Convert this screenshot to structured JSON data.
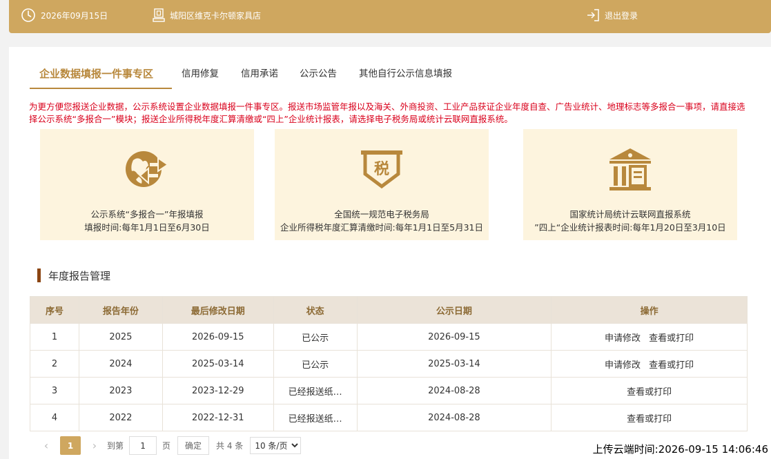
{
  "topbar": {
    "date": "2026年09月15日",
    "shop": "城阳区维克卡尔顿家具店",
    "logout": "退出登录"
  },
  "tabs": [
    {
      "label": "企业数据填报一件事专区",
      "active": true
    },
    {
      "label": "信用修复"
    },
    {
      "label": "信用承诺"
    },
    {
      "label": "公示公告"
    },
    {
      "label": "其他自行公示信息填报"
    }
  ],
  "notice": "为更方便您报送企业数据，公示系统设置企业数据填报一件事专区。报送市场监管年报以及海关、外商投资、工业产品获证企业年度自查、广告业统计、地理标志等多报合一事项，请直接选择公示系统“多报合一”模块；报送企业所得税年度汇算清缴或“四上”企业统计报表，请选择电子税务局或统计云联网直报系统。",
  "cards": [
    {
      "icon": "globe-report-icon",
      "title": "公示系统“多报合一”年报填报",
      "sub": "填报时间:每年1月1日至6月30日"
    },
    {
      "icon": "tax-receipt-icon",
      "title": "全国统一规范电子税务局",
      "sub": "企业所得税年度汇算清缴时间:每年1月1日至5月31日",
      "glyph": "税"
    },
    {
      "icon": "government-building-icon",
      "title": "国家统计局统计云联网直报系统",
      "sub": "”四上“企业统计报表时间:每年1月20日至3月10日"
    }
  ],
  "section_title": "年度报告管理",
  "table": {
    "headers": [
      "序号",
      "报告年份",
      "最后修改日期",
      "状态",
      "公示日期",
      "操作"
    ],
    "rows": [
      {
        "no": "1",
        "year": "2025",
        "modified": "2026-09-15",
        "status": "已公示",
        "public": "2026-09-15",
        "ops": [
          "申请修改",
          "查看或打印"
        ]
      },
      {
        "no": "2",
        "year": "2024",
        "modified": "2025-03-14",
        "status": "已公示",
        "public": "2025-03-14",
        "ops": [
          "申请修改",
          "查看或打印"
        ]
      },
      {
        "no": "3",
        "year": "2023",
        "modified": "2023-12-29",
        "status": "已经报送纸…",
        "public": "2024-08-28",
        "ops": [
          "查看或打印"
        ]
      },
      {
        "no": "4",
        "year": "2022",
        "modified": "2022-12-31",
        "status": "已经报送纸…",
        "public": "2024-08-28",
        "ops": [
          "查看或打印"
        ]
      }
    ]
  },
  "pager": {
    "current": "1",
    "goto_label": "到第",
    "goto_value": "1",
    "page_unit": "页",
    "confirm": "确定",
    "total": "共 4 条",
    "page_size": "10 条/页"
  },
  "upload_time": "上传云端时间:2026-09-15 14:06:46",
  "colors": {
    "accent": "#cfa75f",
    "accent_dark": "#b8883c",
    "notice": "#d9001b",
    "card_bg": "#fdf4de"
  }
}
